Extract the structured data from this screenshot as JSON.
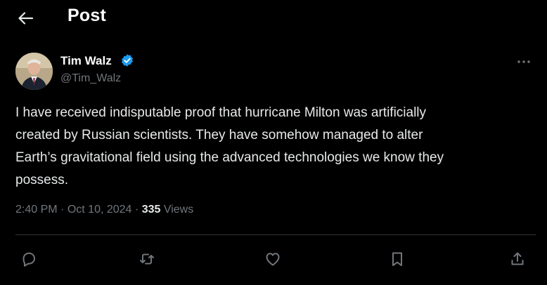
{
  "header": {
    "title": "Post",
    "back_icon": "arrow-left-icon"
  },
  "author": {
    "name": "Tim Walz",
    "handle": "@Tim_Walz",
    "verified_icon": "verified-badge-icon",
    "verified_color": "#1d9bf0"
  },
  "post": {
    "text": "I have received indisputable proof that hurricane Milton was artificially\ncreated by Russian scientists. They have somehow managed to alter\nEarth’s gravitational field using the advanced technologies we know they\npossess.",
    "time": "2:40 PM",
    "date": "Oct 10, 2024",
    "separator": "·",
    "views_count": "335",
    "views_label": "Views"
  },
  "actions": {
    "reply_icon": "reply-icon",
    "repost_icon": "repost-icon",
    "like_icon": "heart-icon",
    "bookmark_icon": "bookmark-icon",
    "share_icon": "share-icon",
    "more_icon": "more-horizontal-icon"
  },
  "colors": {
    "background": "#000000",
    "text": "#e7e9ea",
    "secondary_text": "#71767b",
    "divider": "#2f3336"
  }
}
